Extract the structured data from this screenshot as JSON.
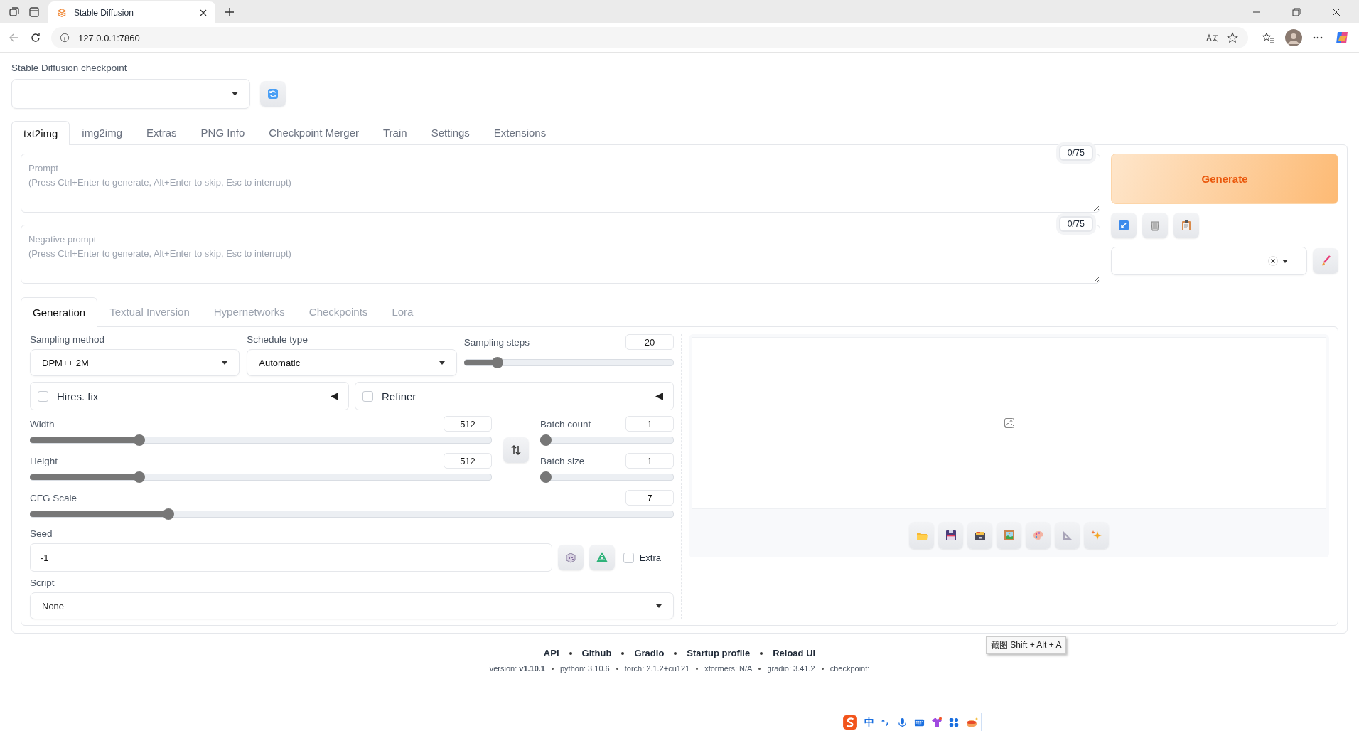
{
  "browser": {
    "tab_title": "Stable Diffusion",
    "url": "127.0.0.1:7860"
  },
  "checkpoint": {
    "label": "Stable Diffusion checkpoint"
  },
  "main_tabs": [
    {
      "label": "txt2img",
      "selected": true
    },
    {
      "label": "img2img",
      "selected": false
    },
    {
      "label": "Extras",
      "selected": false
    },
    {
      "label": "PNG Info",
      "selected": false
    },
    {
      "label": "Checkpoint Merger",
      "selected": false
    },
    {
      "label": "Train",
      "selected": false
    },
    {
      "label": "Settings",
      "selected": false
    },
    {
      "label": "Extensions",
      "selected": false
    }
  ],
  "prompts": [
    {
      "placeholder": "Prompt\n(Press Ctrl+Enter to generate, Alt+Enter to skip, Esc to interrupt)",
      "counter": "0/75"
    },
    {
      "placeholder": "Negative prompt\n(Press Ctrl+Enter to generate, Alt+Enter to skip, Esc to interrupt)",
      "counter": "0/75"
    }
  ],
  "generate_button": "Generate",
  "sub_tabs": [
    {
      "label": "Generation",
      "selected": true
    },
    {
      "label": "Textual Inversion",
      "selected": false
    },
    {
      "label": "Hypernetworks",
      "selected": false
    },
    {
      "label": "Checkpoints",
      "selected": false
    },
    {
      "label": "Lora",
      "selected": false
    }
  ],
  "sampling_method": {
    "label": "Sampling method",
    "value": "DPM++ 2M"
  },
  "schedule_type": {
    "label": "Schedule type",
    "value": "Automatic"
  },
  "sampling_steps": {
    "label": "Sampling steps",
    "value": "20",
    "level": 0.14
  },
  "accordions": [
    {
      "label": "Hires. fix",
      "checked": false
    },
    {
      "label": "Refiner",
      "checked": false
    }
  ],
  "size_sliders": [
    {
      "label": "Width",
      "value": "512",
      "level": 0.23
    },
    {
      "label": "Height",
      "value": "512",
      "level": 0.23
    }
  ],
  "batch_sliders": [
    {
      "label": "Batch count",
      "value": "1",
      "level": 0
    },
    {
      "label": "Batch size",
      "value": "1",
      "level": 0
    }
  ],
  "cfg_scale": {
    "label": "CFG Scale",
    "value": "7",
    "level": 0.21
  },
  "seed": {
    "label": "Seed",
    "value": "-1",
    "extra": {
      "label": "Extra",
      "checked": false
    }
  },
  "script": {
    "label": "Script",
    "value": "None"
  },
  "footer": {
    "links": [
      "API",
      "Github",
      "Gradio",
      "Startup profile",
      "Reload UI"
    ],
    "versions": [
      "version: **v1.10.1**",
      "python: 3.10.6",
      "torch: 2.1.2+cu121",
      "xformers: N/A",
      "gradio: 3.41.2",
      "checkpoint:"
    ]
  },
  "tooltip": "截图 Shift + Alt + A",
  "ime_toolbar": {
    "mode": "中"
  }
}
